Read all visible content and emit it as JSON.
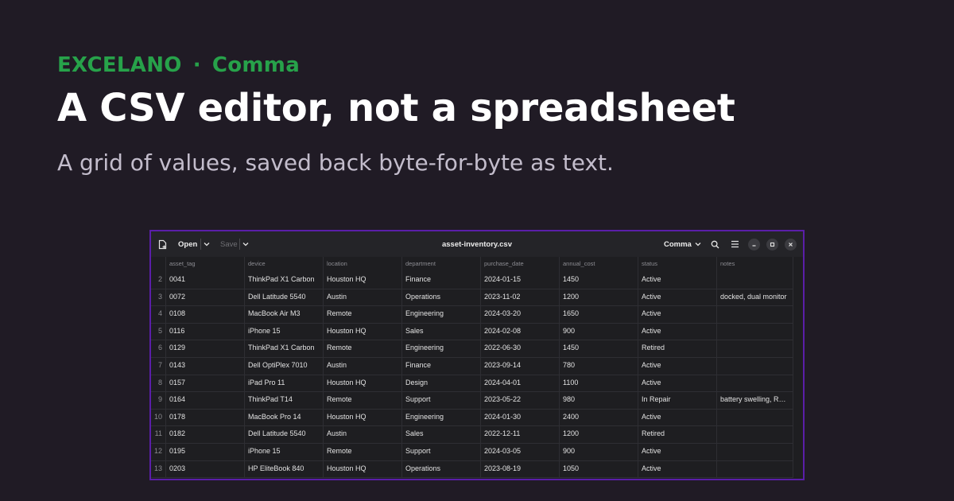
{
  "brand": {
    "name": "EXCELANO",
    "separator": "·",
    "product": "Comma",
    "color": "#27a24a"
  },
  "headline": "A CSV editor, not a spreadsheet",
  "subhead": "A grid of values, saved back byte-for-byte as text.",
  "app": {
    "toolbar": {
      "new_file_icon": "new-file-icon",
      "open_label": "Open",
      "save_label": "Save",
      "file_title": "asset-inventory.csv",
      "delimiter_label": "Comma"
    },
    "grid": {
      "columns": [
        "asset_tag",
        "device",
        "location",
        "department",
        "purchase_date",
        "annual_cost",
        "status",
        "notes"
      ],
      "rows": [
        {
          "num": "2",
          "cells": [
            "0041",
            "ThinkPad X1 Carbon",
            "Houston HQ",
            "Finance",
            "2024-01-15",
            "1450",
            "Active",
            ""
          ]
        },
        {
          "num": "3",
          "cells": [
            "0072",
            "Dell Latitude 5540",
            "Austin",
            "Operations",
            "2023-11-02",
            "1200",
            "Active",
            "docked, dual monitor"
          ]
        },
        {
          "num": "4",
          "cells": [
            "0108",
            "MacBook Air M3",
            "Remote",
            "Engineering",
            "2024-03-20",
            "1650",
            "Active",
            ""
          ]
        },
        {
          "num": "5",
          "cells": [
            "0116",
            "iPhone 15",
            "Houston HQ",
            "Sales",
            "2024-02-08",
            "900",
            "Active",
            ""
          ]
        },
        {
          "num": "6",
          "cells": [
            "0129",
            "ThinkPad X1 Carbon",
            "Remote",
            "Engineering",
            "2022-06-30",
            "1450",
            "Retired",
            ""
          ]
        },
        {
          "num": "7",
          "cells": [
            "0143",
            "Dell OptiPlex 7010",
            "Austin",
            "Finance",
            "2023-09-14",
            "780",
            "Active",
            ""
          ]
        },
        {
          "num": "8",
          "cells": [
            "0157",
            "iPad Pro 11",
            "Houston HQ",
            "Design",
            "2024-04-01",
            "1100",
            "Active",
            ""
          ]
        },
        {
          "num": "9",
          "cells": [
            "0164",
            "ThinkPad T14",
            "Remote",
            "Support",
            "2023-05-22",
            "980",
            "In Repair",
            "battery swelling, R…"
          ]
        },
        {
          "num": "10",
          "cells": [
            "0178",
            "MacBook Pro 14",
            "Houston HQ",
            "Engineering",
            "2024-01-30",
            "2400",
            "Active",
            ""
          ]
        },
        {
          "num": "11",
          "cells": [
            "0182",
            "Dell Latitude 5540",
            "Austin",
            "Sales",
            "2022-12-11",
            "1200",
            "Retired",
            ""
          ]
        },
        {
          "num": "12",
          "cells": [
            "0195",
            "iPhone 15",
            "Remote",
            "Support",
            "2024-03-05",
            "900",
            "Active",
            ""
          ]
        },
        {
          "num": "13",
          "cells": [
            "0203",
            "HP EliteBook 840",
            "Houston HQ",
            "Operations",
            "2023-08-19",
            "1050",
            "Active",
            ""
          ]
        }
      ]
    }
  }
}
